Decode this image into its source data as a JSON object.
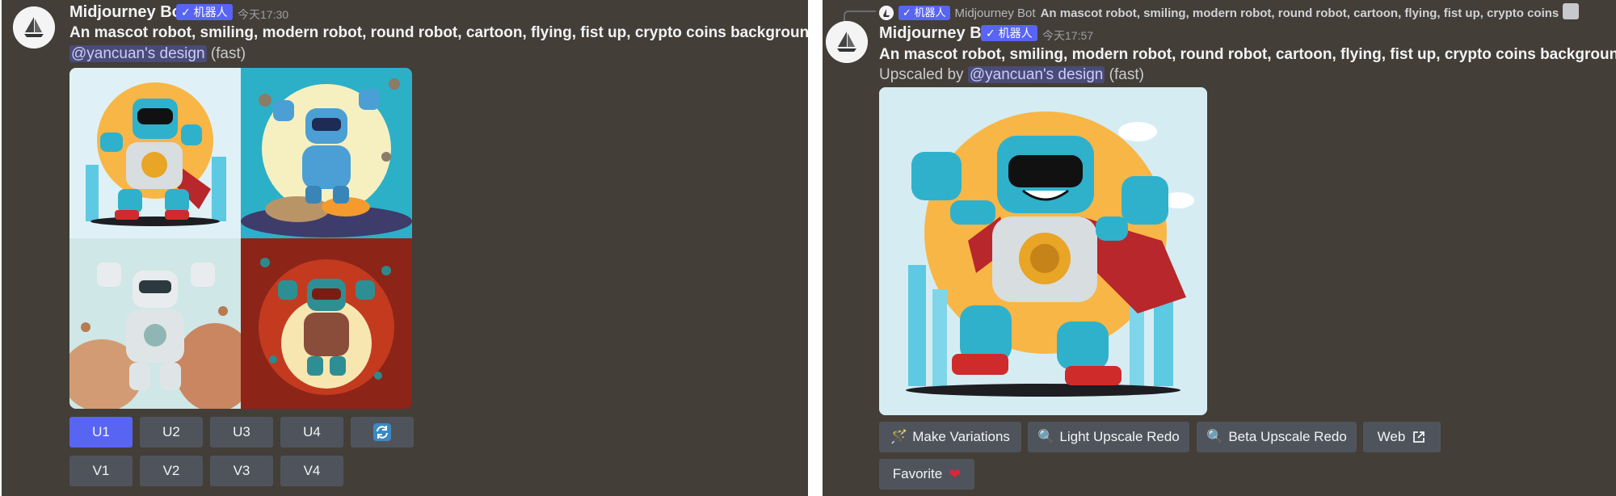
{
  "left": {
    "bot_name": "Midjourney Bot",
    "badge": "✓ 机器人",
    "timestamp": "今天17:30",
    "prompt": "An mascot robot, smiling, modern robot, round robot, cartoon, flying, fist up, crypto coins background",
    "prompt_suffix": " -",
    "mention": "@yancuan's design",
    "mode": "(fast)",
    "upscale_buttons": [
      "U1",
      "U2",
      "U3",
      "U4"
    ],
    "variation_buttons": [
      "V1",
      "V2",
      "V3",
      "V4"
    ],
    "reroll_icon": "refresh-icon"
  },
  "right": {
    "reply_bot_name": "Midjourney Bot",
    "reply_badge": "✓ 机器人",
    "reply_text": "An mascot robot, smiling, modern robot, round robot, cartoon, flying, fist up, crypto coins",
    "bot_name": "Midjourney Bot",
    "badge": "✓ 机器人",
    "timestamp": "今天17:57",
    "prompt": "An mascot robot, smiling, modern robot, round robot, cartoon, flying, fist up, crypto coins background",
    "prompt_suffix": " -",
    "upscaled_by": "Upscaled by ",
    "mention": "@yancuan's design",
    "mode": "(fast)",
    "buttons": {
      "make_variations": "Make Variations",
      "light_upscale": "Light Upscale Redo",
      "beta_upscale": "Beta Upscale Redo",
      "web": "Web",
      "favorite": "Favorite"
    }
  },
  "colors": {
    "background": "#433e37",
    "accent": "#5865f2",
    "button": "#4f545c"
  }
}
